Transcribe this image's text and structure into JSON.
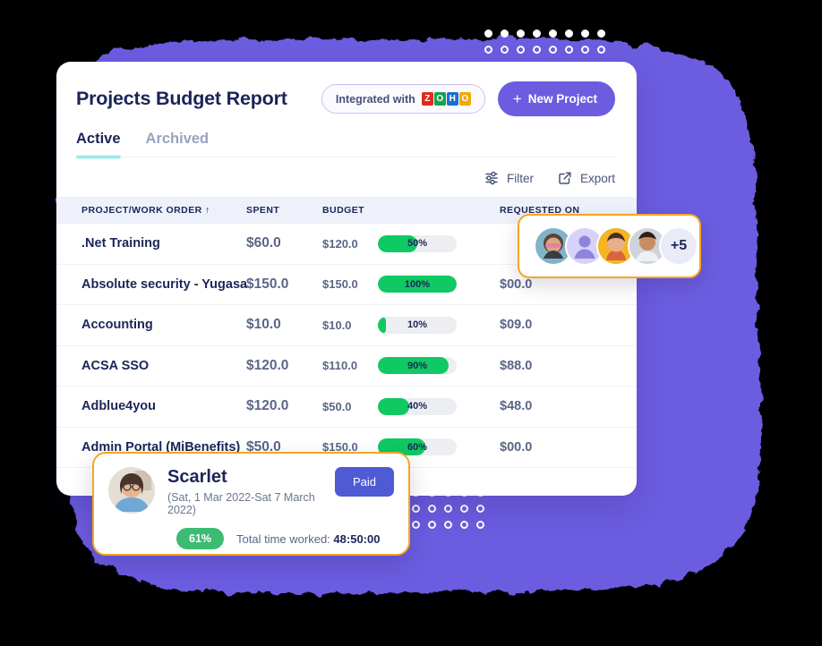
{
  "header": {
    "title": "Projects Budget Report",
    "integrated_label": "Integrated with",
    "zoho_letters": [
      "Z",
      "O",
      "H",
      "O"
    ],
    "new_project_label": "New Project",
    "plus_icon": "plus-icon"
  },
  "tabs": [
    {
      "label": "Active",
      "active": true
    },
    {
      "label": "Archived",
      "active": false
    }
  ],
  "toolbar": {
    "filter_label": "Filter",
    "export_label": "Export"
  },
  "table": {
    "columns": [
      "PROJECT/WORK ORDER ↑",
      "SPENT",
      "BUDGET",
      "",
      "REQUESTED ON"
    ],
    "rows": [
      {
        "name": ".Net Training",
        "spent": "$60.0",
        "budget": "$120.0",
        "percent": "50%",
        "percent_value": 50,
        "requested": ""
      },
      {
        "name": "Absolute security - Yugasa",
        "spent": "$150.0",
        "budget": "$150.0",
        "percent": "100%",
        "percent_value": 100,
        "requested": "$00.0"
      },
      {
        "name": "Accounting",
        "spent": "$10.0",
        "budget": "$10.0",
        "percent": "10%",
        "percent_value": 10,
        "requested": "$09.0"
      },
      {
        "name": "ACSA SSO",
        "spent": "$120.0",
        "budget": "$110.0",
        "percent": "90%",
        "percent_value": 90,
        "requested": "$88.0"
      },
      {
        "name": "Adblue4you",
        "spent": "$120.0",
        "budget": "$50.0",
        "percent": "40%",
        "percent_value": 40,
        "requested": "$48.0"
      },
      {
        "name": "Admin Portal (MiBenefits)",
        "spent": "$50.0",
        "budget": "$150.0",
        "percent": "60%",
        "percent_value": 60,
        "requested": "$00.0"
      }
    ]
  },
  "avatar_popover": {
    "overflow_label": "+5",
    "avatars": [
      "avatar-1",
      "avatar-2-placeholder",
      "avatar-3",
      "avatar-4"
    ]
  },
  "scarlet_popover": {
    "name": "Scarlet",
    "dates": "(Sat, 1 Mar 2022-Sat 7 March 2022)",
    "status_label": "Paid",
    "percent": "61%",
    "total_label": "Total time worked:",
    "total_value": "48:50:00"
  },
  "colors": {
    "brand_purple": "#6c5ce0",
    "accent_green": "#0fc963",
    "accent_teal": "#5fe0dc",
    "popover_border": "#f5a623",
    "paid_blue": "#4f5bd5",
    "text_dark": "#1b2559"
  }
}
